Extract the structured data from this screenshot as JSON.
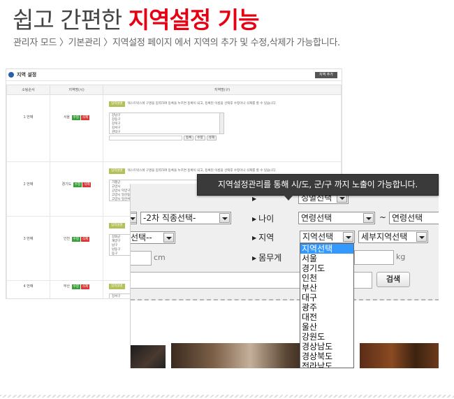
{
  "header": {
    "title_prefix": "쉽고 간편한 ",
    "title_highlight": "지역설정 기능",
    "subtitle": "관리자 모드 〉기본관리 〉지역설정 페이지 에서  지역의 추가 및 수정,삭제가 가능합니다.",
    "highlight_color": "#e60012"
  },
  "admin": {
    "title": "지역 설정",
    "add_button": "지역 추가",
    "columns": [
      "소팅순서",
      "지역명(시)",
      "지역명(구)"
    ],
    "edit_label": "수정",
    "delete_label": "삭제",
    "tip_label": "입력설명",
    "tip_text": "텍스트박스에 구명을 입력하여 등록을 누르면 등록이 되고, 등록된 이름을 선택후 수정이나 삭제를 할 수 있습니다.",
    "register_label": "등록",
    "rows": [
      {
        "order": "1 번째",
        "city": "서울",
        "districts": [
          "강남구",
          "강동구",
          "강북구",
          "강서구",
          "관악구"
        ]
      },
      {
        "order": "2 번째",
        "city": "경기도",
        "districts": [
          "가평군",
          "고양시",
          "고양시 덕양구",
          "고양시 일산동구",
          "고양시 일산서구"
        ]
      },
      {
        "order": "3 번째",
        "city": "인천",
        "districts": [
          "강화군",
          "계양구",
          "남구",
          "남동구",
          "동구"
        ]
      },
      {
        "order": "4 번째",
        "city": "부산",
        "districts": [
          "강서구"
        ]
      }
    ]
  },
  "zoom": {
    "row1_select": "성별선택",
    "row2_job": "-2차 직종선택-",
    "age_label": "나이",
    "age_from": "연령선택",
    "age_sep": "~",
    "age_to": "연령선택",
    "region_left": "선택--",
    "region_label": "지역",
    "region_select": "지역선택",
    "region_detail": "세부지역선택",
    "height_unit": "cm",
    "weight_label": "몸무게",
    "weight_unit": "kg",
    "search_button": "검색"
  },
  "dropdown": {
    "options": [
      "지역선택",
      "서울",
      "경기도",
      "인천",
      "부산",
      "대구",
      "광주",
      "대전",
      "울산",
      "강원도",
      "경상남도",
      "경상북도",
      "전라남도"
    ],
    "selected_color": "#3399ff"
  },
  "tooltip": {
    "text": "지역설정관리를 통해 시/도, 군/구 까지 노출이 가능합니다."
  }
}
